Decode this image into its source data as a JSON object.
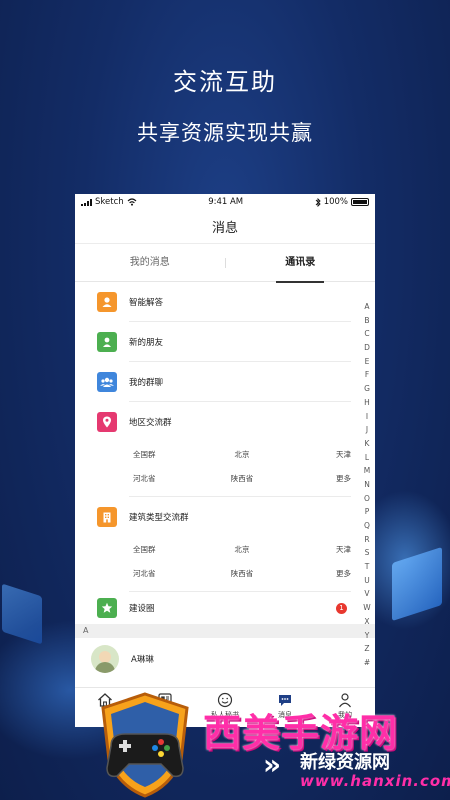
{
  "hero": {
    "title": "交流互助",
    "subtitle": "共享资源实现共赢"
  },
  "status_bar": {
    "carrier": "Sketch",
    "time": "9:41 AM",
    "battery": "100%"
  },
  "nav": {
    "title": "消息"
  },
  "tabs": [
    {
      "label": "我的消息",
      "active": false
    },
    {
      "label": "通讯录",
      "active": true
    }
  ],
  "groups": [
    {
      "label": "智能解答",
      "icon": "user-icon",
      "color": "#f5962c"
    },
    {
      "label": "新的朋友",
      "icon": "person-icon",
      "color": "#4caf50"
    },
    {
      "label": "我的群聊",
      "icon": "group-icon",
      "color": "#3f86dc"
    },
    {
      "label": "地区交流群",
      "icon": "location-pin-icon",
      "color": "#e53970"
    }
  ],
  "region_grid": [
    [
      "全国群",
      "北京",
      "天津"
    ],
    [
      "河北省",
      "陕西省",
      "更多"
    ]
  ],
  "building_group": {
    "label": "建筑类型交流群",
    "icon": "building-icon",
    "color": "#f5962c"
  },
  "building_grid": [
    [
      "全国群",
      "北京",
      "天津"
    ],
    [
      "河北省",
      "陕西省",
      "更多"
    ]
  ],
  "circle": {
    "label": "建设圈",
    "icon": "star-icon",
    "color": "#4caf50",
    "badge": "1"
  },
  "section": {
    "header": "A"
  },
  "contacts": [
    {
      "name": "A琳琳",
      "icon": "avatar"
    }
  ],
  "index_letters": [
    "A",
    "B",
    "C",
    "D",
    "E",
    "F",
    "G",
    "H",
    "I",
    "J",
    "K",
    "L",
    "M",
    "N",
    "O",
    "P",
    "Q",
    "R",
    "S",
    "T",
    "U",
    "V",
    "W",
    "X",
    "Y",
    "Z",
    "#"
  ],
  "tabbar": [
    {
      "label": "",
      "icon": "home-icon"
    },
    {
      "label": "",
      "icon": "news-icon"
    },
    {
      "label": "私人秘书",
      "icon": "smile-icon"
    },
    {
      "label": "消息",
      "icon": "chat-icon"
    },
    {
      "label": "我的",
      "icon": "profile-icon"
    }
  ],
  "watermark": {
    "brand": "西美手游网",
    "sub": "新绿资源网",
    "url": "www.hanxin.com"
  }
}
